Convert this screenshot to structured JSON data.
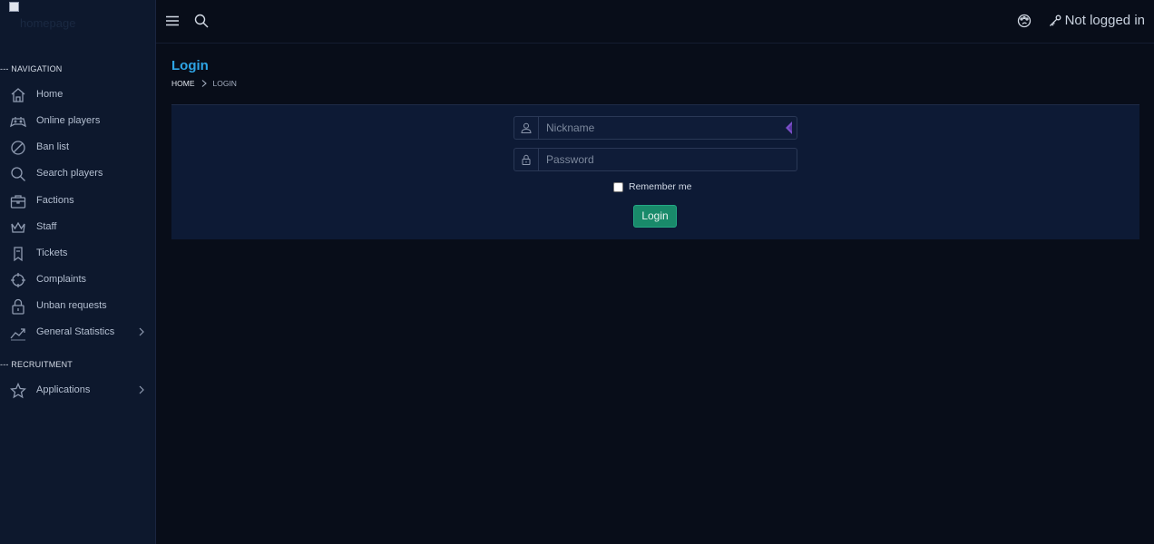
{
  "logo": {
    "alt": "homepage"
  },
  "sidebar": {
    "sections": [
      {
        "title": "--- NAVIGATION"
      },
      {
        "title": "--- RECRUITMENT"
      }
    ],
    "items": [
      {
        "label": "Home",
        "icon": "home-icon"
      },
      {
        "label": "Online players",
        "icon": "gamepad-icon"
      },
      {
        "label": "Ban list",
        "icon": "ban-icon"
      },
      {
        "label": "Search players",
        "icon": "search-icon"
      },
      {
        "label": "Factions",
        "icon": "briefcase-icon"
      },
      {
        "label": "Staff",
        "icon": "crown-icon"
      },
      {
        "label": "Tickets",
        "icon": "bookmark-icon"
      },
      {
        "label": "Complaints",
        "icon": "crosshair-icon"
      },
      {
        "label": "Unban requests",
        "icon": "lock-icon"
      },
      {
        "label": "General Statistics",
        "icon": "trend-icon"
      },
      {
        "label": "Applications",
        "icon": "star-icon"
      }
    ]
  },
  "topbar": {
    "menu_icon": "hamburger-icon",
    "search_icon": "search-icon",
    "theme_icon": "palette-icon",
    "user_status": "Not logged in"
  },
  "page": {
    "title": "Login",
    "breadcrumb": {
      "home": "HOME",
      "current": "LOGIN"
    }
  },
  "form": {
    "nickname_placeholder": "Nickname",
    "password_placeholder": "Password",
    "remember_label": "Remember me",
    "submit_label": "Login"
  },
  "colors": {
    "accent": "#2ea5e6",
    "button": "#198a6a",
    "sidebar_bg": "#0d182d",
    "page_bg": "#080d19",
    "card_bg": "#0d1a35"
  }
}
